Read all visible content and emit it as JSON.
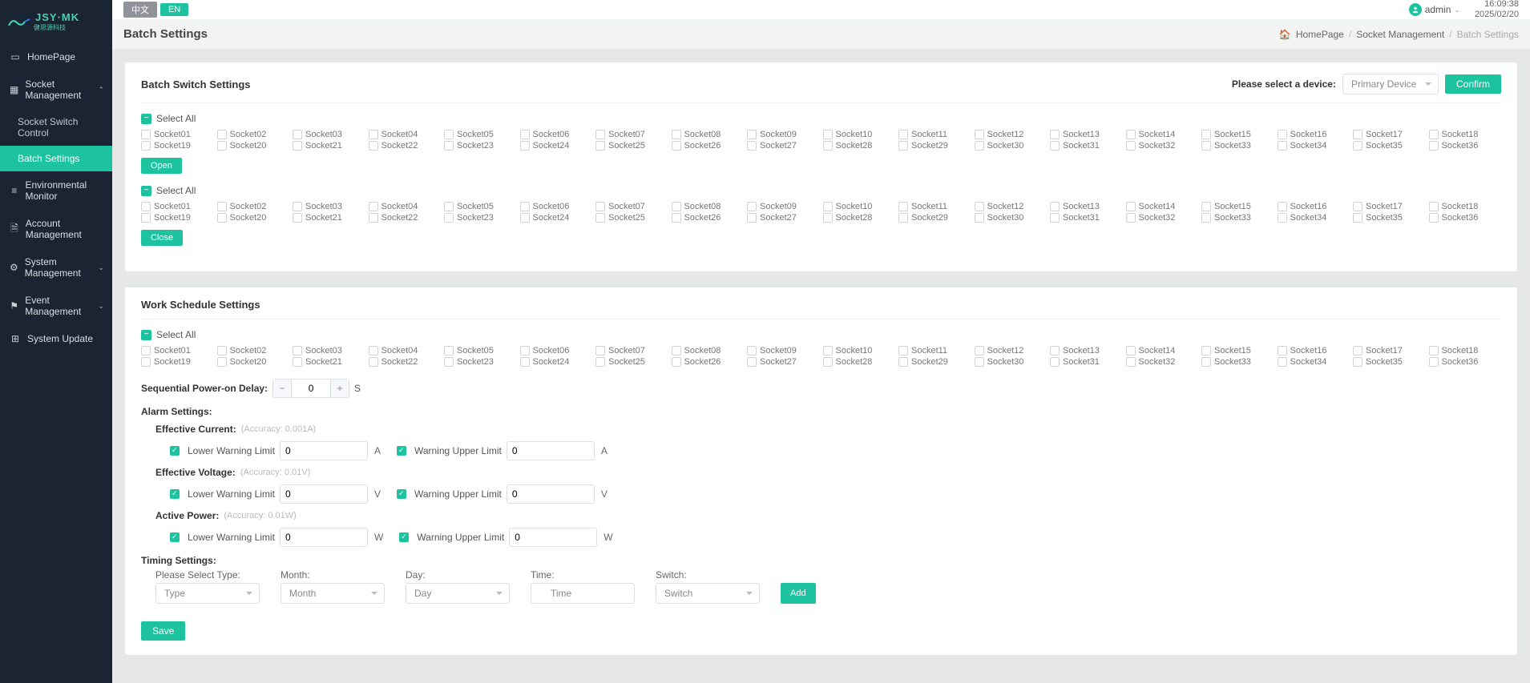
{
  "brand": {
    "name": "JSY·MK",
    "sub": "健思源科技"
  },
  "nav": {
    "home": "HomePage",
    "socket_mgmt": "Socket Management",
    "socket_switch": "Socket Switch Control",
    "batch_settings": "Batch Settings",
    "env_monitor": "Environmental Monitor",
    "account_mgmt": "Account Management",
    "system_mgmt": "System Management",
    "event_mgmt": "Event Management",
    "system_update": "System Update"
  },
  "topbar": {
    "lang_cn": "中文",
    "lang_en": "EN",
    "user": "admin",
    "time": "16:09:38",
    "date": "2025/02/20"
  },
  "page": {
    "title": "Batch Settings",
    "crumbs": {
      "home": "HomePage",
      "socket": "Socket Management",
      "batch": "Batch Settings"
    }
  },
  "panel1": {
    "title": "Batch Switch Settings",
    "device_label": "Please select a device:",
    "device_value": "Primary Device",
    "confirm": "Confirm",
    "select_all": "Select All",
    "open": "Open",
    "close": "Close"
  },
  "panel2": {
    "title": "Work Schedule Settings",
    "select_all": "Select All",
    "seq_label": "Sequential Power-on Delay:",
    "seq_value": "0",
    "seq_unit": "S",
    "alarm_title": "Alarm Settings:",
    "eff_current": "Effective Current:",
    "acc_current": "(Accuracy: 0.001A)",
    "eff_voltage": "Effective Voltage:",
    "acc_voltage": "(Accuracy: 0.01V)",
    "active_power": "Active Power:",
    "acc_power": "(Accuracy: 0.01W)",
    "lower_limit": "Lower Warning Limit",
    "upper_limit": "Warning Upper Limit",
    "val_zero": "0",
    "unit_a": "A",
    "unit_v": "V",
    "unit_w": "W",
    "timing_title": "Timing Settings:",
    "type_label": "Please Select Type:",
    "type_ph": "Type",
    "month_label": "Month:",
    "month_ph": "Month",
    "day_label": "Day:",
    "day_ph": "Day",
    "time_label": "Time:",
    "time_ph": "Time",
    "switch_label": "Switch:",
    "switch_ph": "Switch",
    "add": "Add",
    "save": "Save"
  },
  "sockets": [
    "Socket01",
    "Socket02",
    "Socket03",
    "Socket04",
    "Socket05",
    "Socket06",
    "Socket07",
    "Socket08",
    "Socket09",
    "Socket10",
    "Socket11",
    "Socket12",
    "Socket13",
    "Socket14",
    "Socket15",
    "Socket16",
    "Socket17",
    "Socket18",
    "Socket19",
    "Socket20",
    "Socket21",
    "Socket22",
    "Socket23",
    "Socket24",
    "Socket25",
    "Socket26",
    "Socket27",
    "Socket28",
    "Socket29",
    "Socket30",
    "Socket31",
    "Socket32",
    "Socket33",
    "Socket34",
    "Socket35",
    "Socket36"
  ]
}
